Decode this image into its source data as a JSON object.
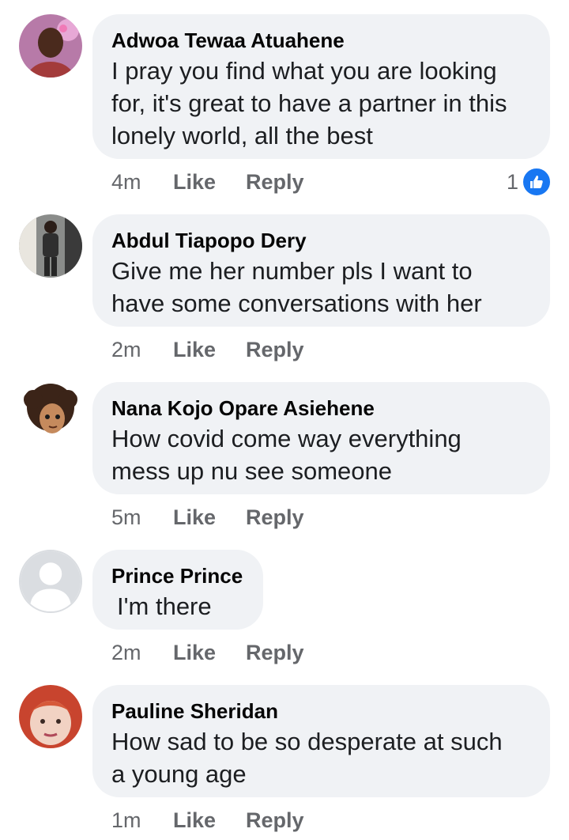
{
  "comments": [
    {
      "author": "Adwoa Tewaa Atuahene",
      "text": "I pray you find what you are looking\nfor, it's great to have a partner in this\nlonely world,  all the best",
      "time": "4m",
      "like_label": "Like",
      "reply_label": "Reply",
      "reaction_count": "1",
      "reaction_icon": "thumbs-up-icon"
    },
    {
      "author": "Abdul Tiapopo Dery",
      "text": "Give me her number pls I want to\nhave some conversations with her",
      "time": "2m",
      "like_label": "Like",
      "reply_label": "Reply"
    },
    {
      "author": "Nana Kojo Opare Asiehene",
      "text": "How covid come way everything\nmess up nu see someone",
      "time": "5m",
      "like_label": "Like",
      "reply_label": "Reply"
    },
    {
      "author": "Prince Prince",
      "text": "I'm there",
      "time": "2m",
      "like_label": "Like",
      "reply_label": "Reply"
    },
    {
      "author": "Pauline Sheridan",
      "text": "How sad to be so desperate at such\na young age",
      "time": "1m",
      "like_label": "Like",
      "reply_label": "Reply"
    }
  ],
  "colors": {
    "bubble": "#f0f2f5",
    "meta": "#65676b",
    "like_blue": "#1877f2"
  }
}
